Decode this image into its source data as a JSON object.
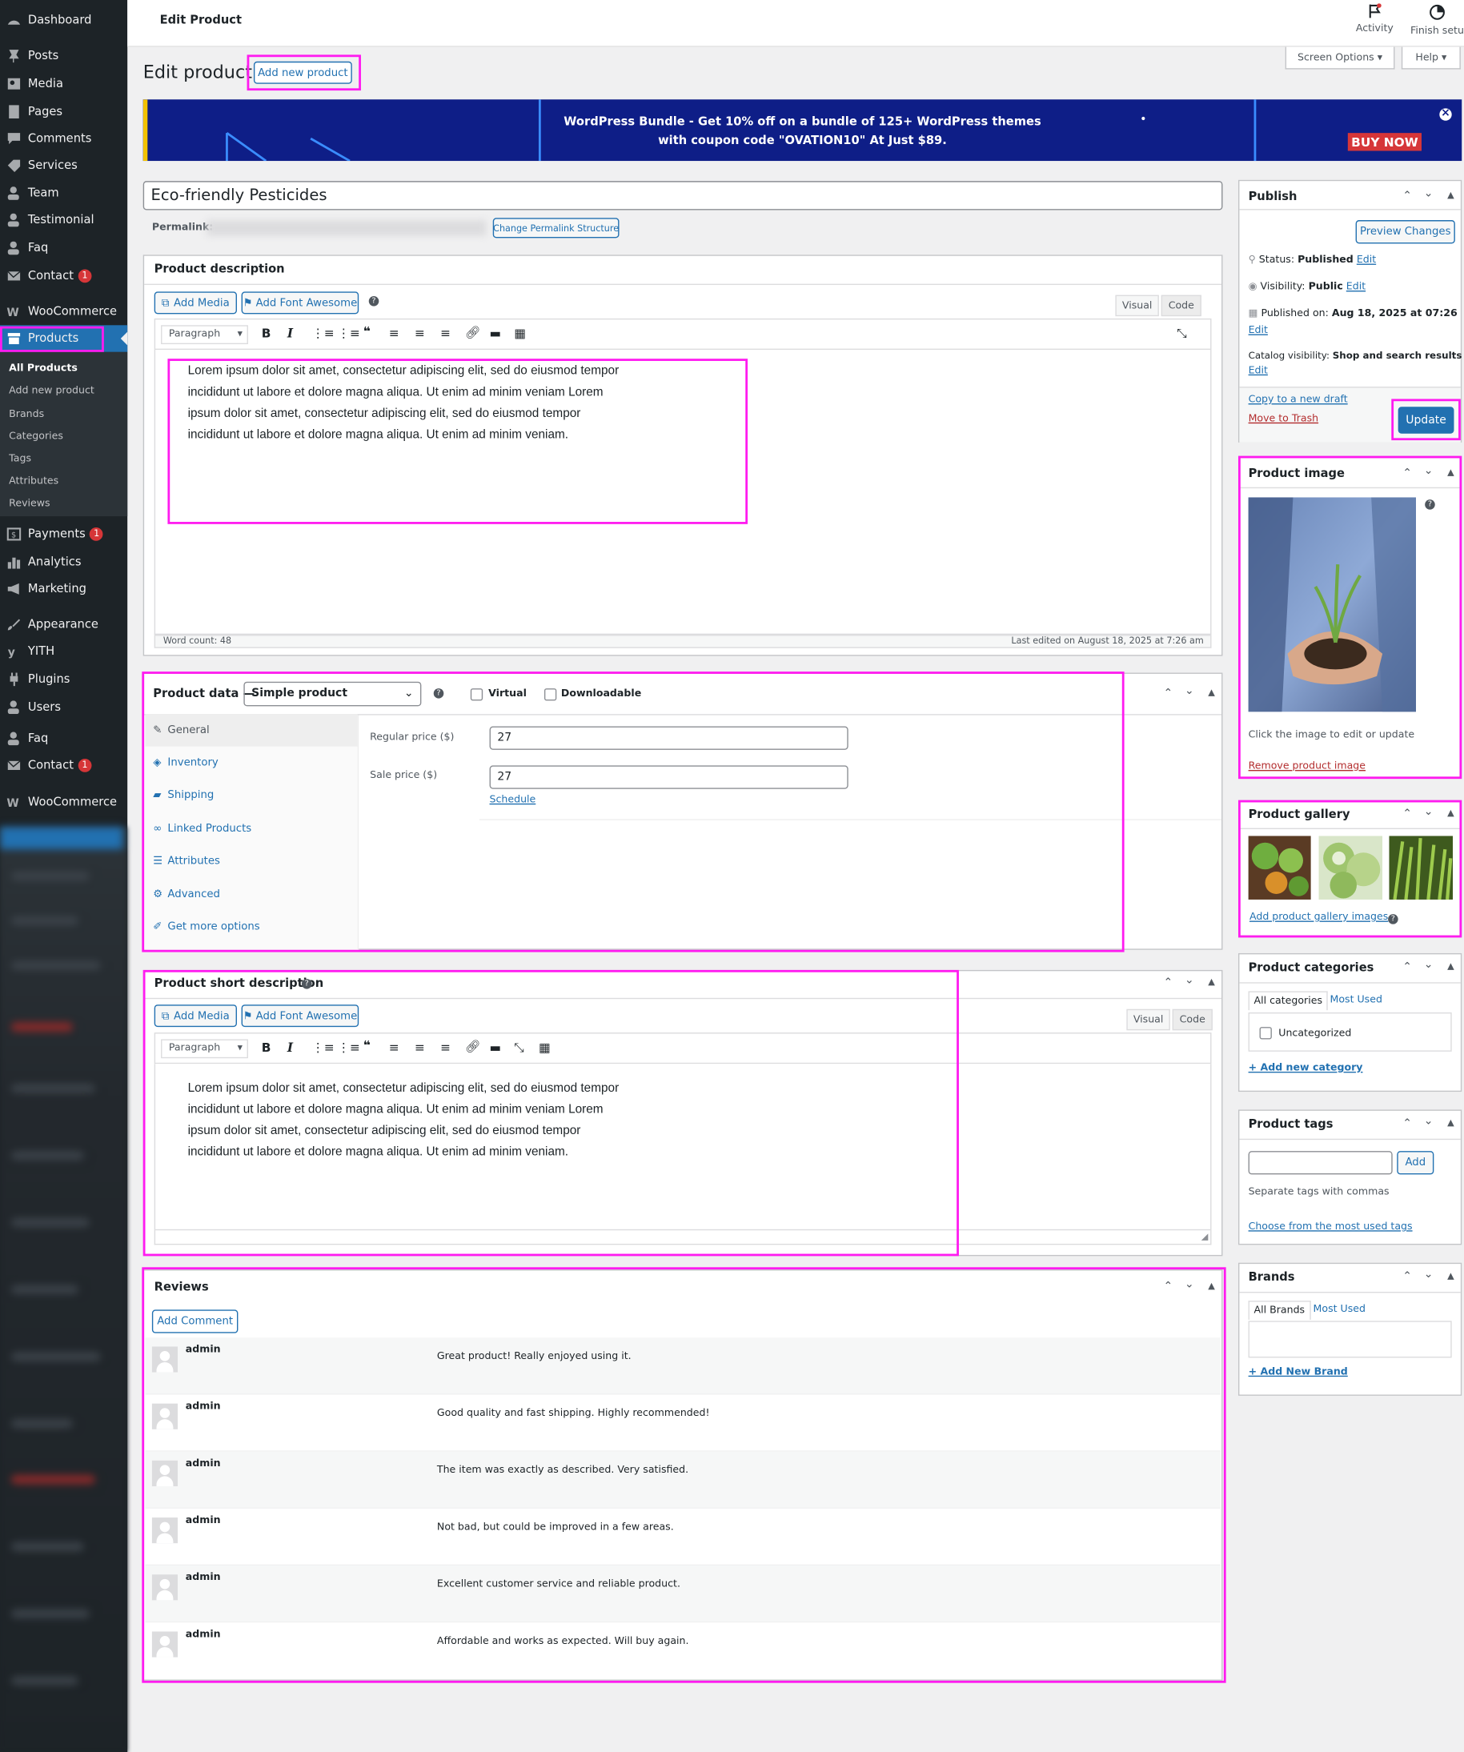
{
  "sidebar": {
    "items": [
      {
        "label": "Dashboard",
        "icon": "dashboard-icon"
      },
      {
        "label": "Posts",
        "icon": "pushpin-icon"
      },
      {
        "label": "Media",
        "icon": "media-icon"
      },
      {
        "label": "Pages",
        "icon": "pages-icon"
      },
      {
        "label": "Comments",
        "icon": "comments-icon"
      },
      {
        "label": "Services",
        "icon": "tag-icon"
      },
      {
        "label": "Team",
        "icon": "person-icon"
      },
      {
        "label": "Testimonial",
        "icon": "person-icon"
      },
      {
        "label": "Faq",
        "icon": "person-icon"
      },
      {
        "label": "Contact",
        "icon": "mail-icon",
        "badge": "1"
      },
      {
        "label": "WooCommerce",
        "icon": "woo-icon"
      },
      {
        "label": "Products",
        "icon": "archive-icon"
      },
      {
        "label": "Payments",
        "icon": "payments-icon",
        "badge": "1"
      },
      {
        "label": "Analytics",
        "icon": "analytics-icon"
      },
      {
        "label": "Marketing",
        "icon": "megaphone-icon"
      },
      {
        "label": "Appearance",
        "icon": "brush-icon"
      },
      {
        "label": "YITH",
        "icon": "yith-icon"
      },
      {
        "label": "Plugins",
        "icon": "plug-icon"
      },
      {
        "label": "Users",
        "icon": "person-icon"
      },
      {
        "label": "Faq",
        "icon": "person-icon"
      },
      {
        "label": "Contact",
        "icon": "mail-icon",
        "badge": "1"
      },
      {
        "label": "WooCommerce",
        "icon": "woo-icon"
      }
    ],
    "submenu": [
      "All Products",
      "Add new product",
      "Brands",
      "Categories",
      "Tags",
      "Attributes",
      "Reviews"
    ]
  },
  "topbar": {
    "title": "Edit Product",
    "activity": "Activity",
    "finish": "Finish setup"
  },
  "header": {
    "title": "Edit product",
    "add_new": "Add new product",
    "screen_options": "Screen Options ▾",
    "help": "Help ▾"
  },
  "banner": {
    "line1": "WordPress Bundle - Get 10% off on a bundle of 125+ WordPress themes",
    "line2": "with coupon code \"OVATION10\" At Just $89.",
    "buy": "BUY NOW",
    "close": "×"
  },
  "product": {
    "title": "Eco-friendly Pesticides",
    "permalink_label": "Permalink:",
    "change_permalink": "Change Permalink Structure"
  },
  "description": {
    "title": "Product description",
    "add_media": "Add Media",
    "add_font": "Add Font Awesome",
    "tab_visual": "Visual",
    "tab_code": "Code",
    "format": "Paragraph",
    "lines": [
      "Lorem ipsum dolor sit amet, consectetur adipiscing elit, sed do eiusmod tempor",
      "incididunt ut labore et dolore magna aliqua. Ut enim ad minim veniam Lorem",
      "ipsum dolor sit amet, consectetur adipiscing elit, sed do eiusmod tempor",
      "incididunt ut labore et dolore magna aliqua. Ut enim ad minim veniam."
    ],
    "word_count": "Word count: 48",
    "last_edited": "Last edited on August 18, 2025 at 7:26 am"
  },
  "product_data": {
    "title": "Product data —",
    "type": "Simple product",
    "virtual": "Virtual",
    "downloadable": "Downloadable",
    "tabs": [
      "General",
      "Inventory",
      "Shipping",
      "Linked Products",
      "Attributes",
      "Advanced",
      "Get more options"
    ],
    "regular_label": "Regular price ($)",
    "regular_value": "27",
    "sale_label": "Sale price ($)",
    "sale_value": "27",
    "schedule": "Schedule"
  },
  "short_desc": {
    "title": "Product short description",
    "add_media": "Add Media",
    "add_font": "Add Font Awesome",
    "tab_visual": "Visual",
    "tab_code": "Code",
    "format": "Paragraph",
    "lines": [
      "Lorem ipsum dolor sit amet, consectetur adipiscing elit, sed do eiusmod tempor",
      "incididunt ut labore et dolore magna aliqua. Ut enim ad minim veniam Lorem",
      "ipsum dolor sit amet, consectetur adipiscing elit, sed do eiusmod tempor",
      "incididunt ut labore et dolore magna aliqua. Ut enim ad minim veniam."
    ]
  },
  "reviews": {
    "title": "Reviews",
    "add_comment": "Add Comment",
    "items": [
      {
        "user": "admin",
        "text": "Great product! Really enjoyed using it."
      },
      {
        "user": "admin",
        "text": "Good quality and fast shipping. Highly recommended!"
      },
      {
        "user": "admin",
        "text": "The item was exactly as described. Very satisfied."
      },
      {
        "user": "admin",
        "text": "Not bad, but could be improved in a few areas."
      },
      {
        "user": "admin",
        "text": "Excellent customer service and reliable product."
      },
      {
        "user": "admin",
        "text": "Affordable and works as expected. Will buy again."
      }
    ]
  },
  "publish": {
    "title": "Publish",
    "preview": "Preview Changes",
    "status_label": "Status:",
    "status": "Published",
    "visibility_label": "Visibility:",
    "visibility": "Public",
    "published_label": "Published on:",
    "published": "Aug 18, 2025 at 07:26",
    "catalog_label": "Catalog visibility:",
    "catalog": "Shop and search results",
    "edit": "Edit",
    "copy": "Copy to a new draft",
    "trash": "Move to Trash",
    "update": "Update"
  },
  "image": {
    "title": "Product image",
    "hint": "Click the image to edit or update",
    "remove": "Remove product image"
  },
  "gallery": {
    "title": "Product gallery",
    "add": "Add product gallery images"
  },
  "categories": {
    "title": "Product categories",
    "tab_all": "All categories",
    "tab_used": "Most Used",
    "item": "Uncategorized",
    "add": "+ Add new category"
  },
  "tags": {
    "title": "Product tags",
    "add": "Add",
    "hint": "Separate tags with commas",
    "choose": "Choose from the most used tags"
  },
  "brands": {
    "title": "Brands",
    "tab_all": "All Brands",
    "tab_used": "Most Used",
    "add": "+ Add New Brand"
  },
  "colors": {
    "accent": "#2271b1",
    "highlight": "#ff1bf0",
    "sidebar": "#1d2327",
    "banner": "#0e1e87"
  }
}
